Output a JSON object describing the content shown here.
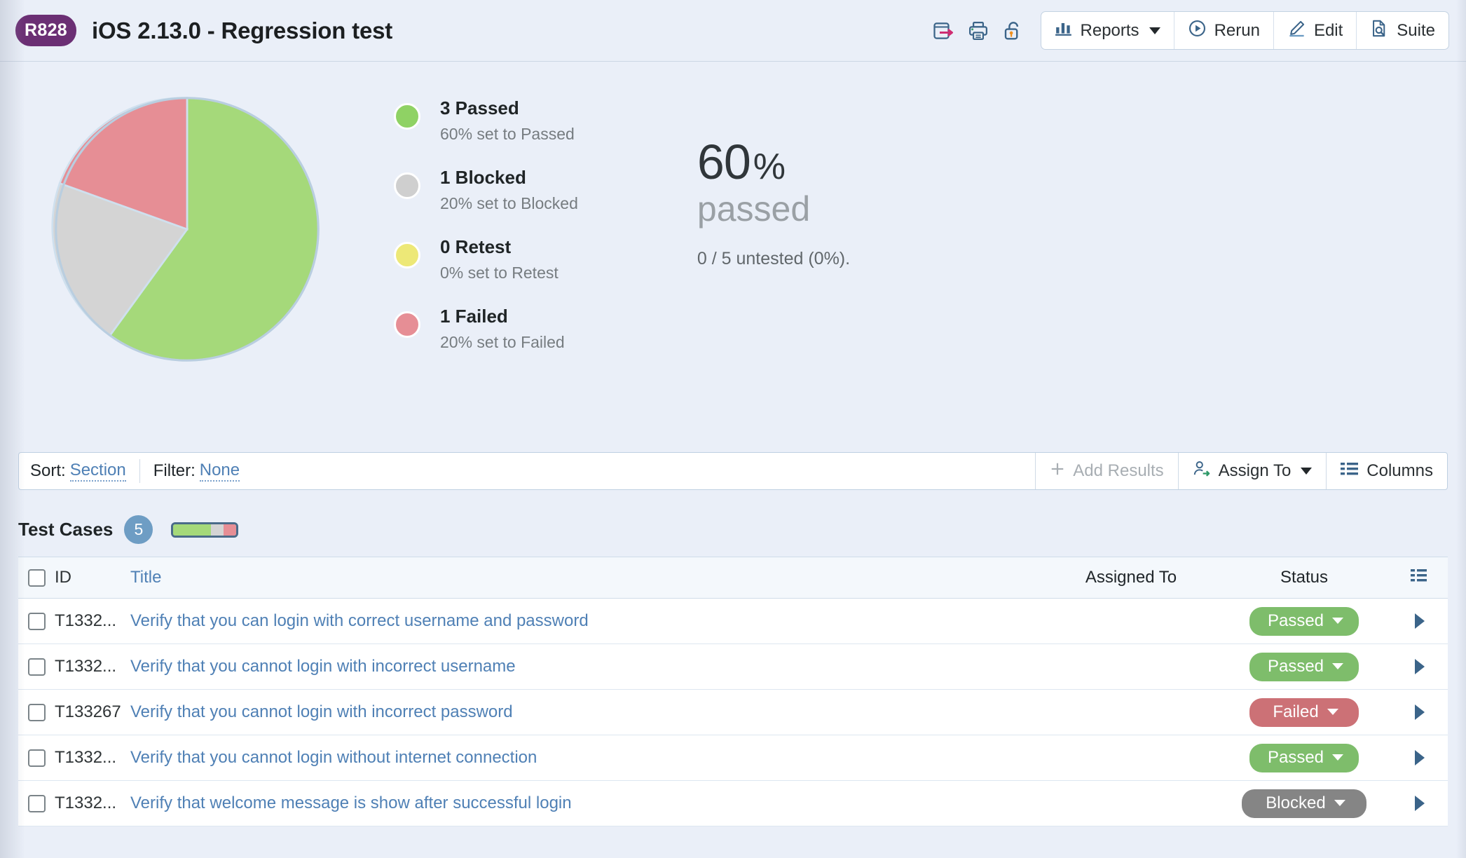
{
  "header": {
    "run_badge": "R828",
    "title": "iOS 2.13.0 - Regression test",
    "icons": [
      {
        "name": "export-icon"
      },
      {
        "name": "print-icon"
      },
      {
        "name": "lock-icon"
      }
    ],
    "buttons": [
      {
        "label": "Reports",
        "icon": "bar-chart-icon",
        "has_chevron": true
      },
      {
        "label": "Rerun",
        "icon": "play-circle-icon",
        "has_chevron": false
      },
      {
        "label": "Edit",
        "icon": "pencil-icon",
        "has_chevron": false
      },
      {
        "label": "Suite",
        "icon": "document-search-icon",
        "has_chevron": false
      }
    ]
  },
  "summary": {
    "legend": [
      {
        "count": "3 Passed",
        "sub": "60% set to Passed",
        "color": "#8FD264"
      },
      {
        "count": "1 Blocked",
        "sub": "20% set to Blocked",
        "color": "#CFCFCF"
      },
      {
        "count": "0 Retest",
        "sub": "0% set to Retest",
        "color": "#EDE877"
      },
      {
        "count": "1 Failed",
        "sub": "20% set to Failed",
        "color": "#E68E95"
      }
    ],
    "percent_value": "60",
    "percent_symbol": "%",
    "percent_word": "passed",
    "untested_note": "0 / 5 untested (0%)."
  },
  "chart_data": {
    "type": "pie",
    "title": "",
    "categories": [
      "Passed",
      "Blocked",
      "Retest",
      "Failed"
    ],
    "values": [
      3,
      1,
      0,
      1
    ],
    "percentages": [
      60,
      20,
      0,
      20
    ],
    "colors": [
      "#A5D97A",
      "#D4D4D4",
      "#EDE877",
      "#E68E95"
    ],
    "total": 5,
    "legend_position": "right",
    "start_angle": 0,
    "direction": "clockwise"
  },
  "filter_bar": {
    "sort_label": "Sort:",
    "sort_value": "Section",
    "filter_label": "Filter:",
    "filter_value": "None",
    "add_results": "Add Results",
    "assign_to": "Assign To",
    "columns": "Columns"
  },
  "test_cases": {
    "title": "Test Cases",
    "count": "5",
    "progress": [
      {
        "label": "Passed",
        "percent": 60,
        "color": "#A5D97A"
      },
      {
        "label": "Blocked",
        "percent": 20,
        "color": "#D4D4D4"
      },
      {
        "label": "Failed",
        "percent": 20,
        "color": "#E68E95"
      }
    ],
    "columns": [
      "ID",
      "Title",
      "Assigned To",
      "Status"
    ],
    "rows": [
      {
        "id": "T1332...",
        "title": "Verify that you can login with correct username and password",
        "assigned_to": "",
        "status": "Passed",
        "status_color": "#7EBD6B"
      },
      {
        "id": "T1332...",
        "title": "Verify that you cannot login with incorrect username",
        "assigned_to": "",
        "status": "Passed",
        "status_color": "#7EBD6B"
      },
      {
        "id": "T133267",
        "title": "Verify that you cannot login with incorrect password",
        "assigned_to": "",
        "status": "Failed",
        "status_color": "#CC7176"
      },
      {
        "id": "T1332...",
        "title": "Verify that you cannot login without internet connection",
        "assigned_to": "",
        "status": "Passed",
        "status_color": "#7EBD6B"
      },
      {
        "id": "T1332...",
        "title": "Verify that welcome message is show after successful login",
        "assigned_to": "",
        "status": "Blocked",
        "status_color": "#858585"
      }
    ]
  }
}
